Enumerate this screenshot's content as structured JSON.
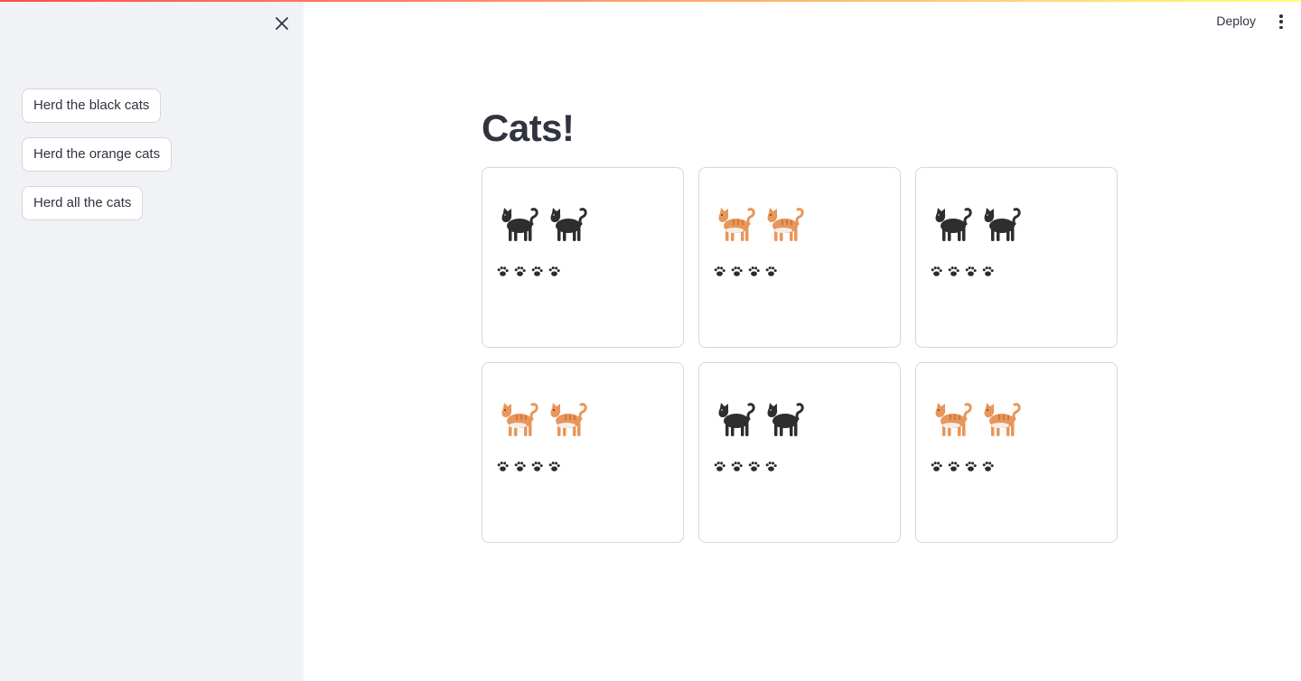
{
  "sidebar": {
    "buttons": [
      {
        "label": "Herd the black cats"
      },
      {
        "label": "Herd the orange cats"
      },
      {
        "label": "Herd all the cats"
      }
    ]
  },
  "header": {
    "deploy_label": "Deploy"
  },
  "main": {
    "title": "Cats!",
    "cards": [
      {
        "cat": "black-cat-icon",
        "count": 2,
        "paws": 4
      },
      {
        "cat": "orange-cat-icon",
        "count": 2,
        "paws": 4
      },
      {
        "cat": "black-cat-icon",
        "count": 2,
        "paws": 4
      },
      {
        "cat": "orange-cat-icon",
        "count": 2,
        "paws": 4
      },
      {
        "cat": "black-cat-icon",
        "count": 2,
        "paws": 4
      },
      {
        "cat": "orange-cat-icon",
        "count": 2,
        "paws": 4
      }
    ]
  },
  "colors": {
    "accent": "#ff4b4b",
    "sidebar_bg": "#f0f2f6",
    "text": "#31333f",
    "black_cat": "#2e2e30",
    "orange_cat": "#e8965a"
  }
}
